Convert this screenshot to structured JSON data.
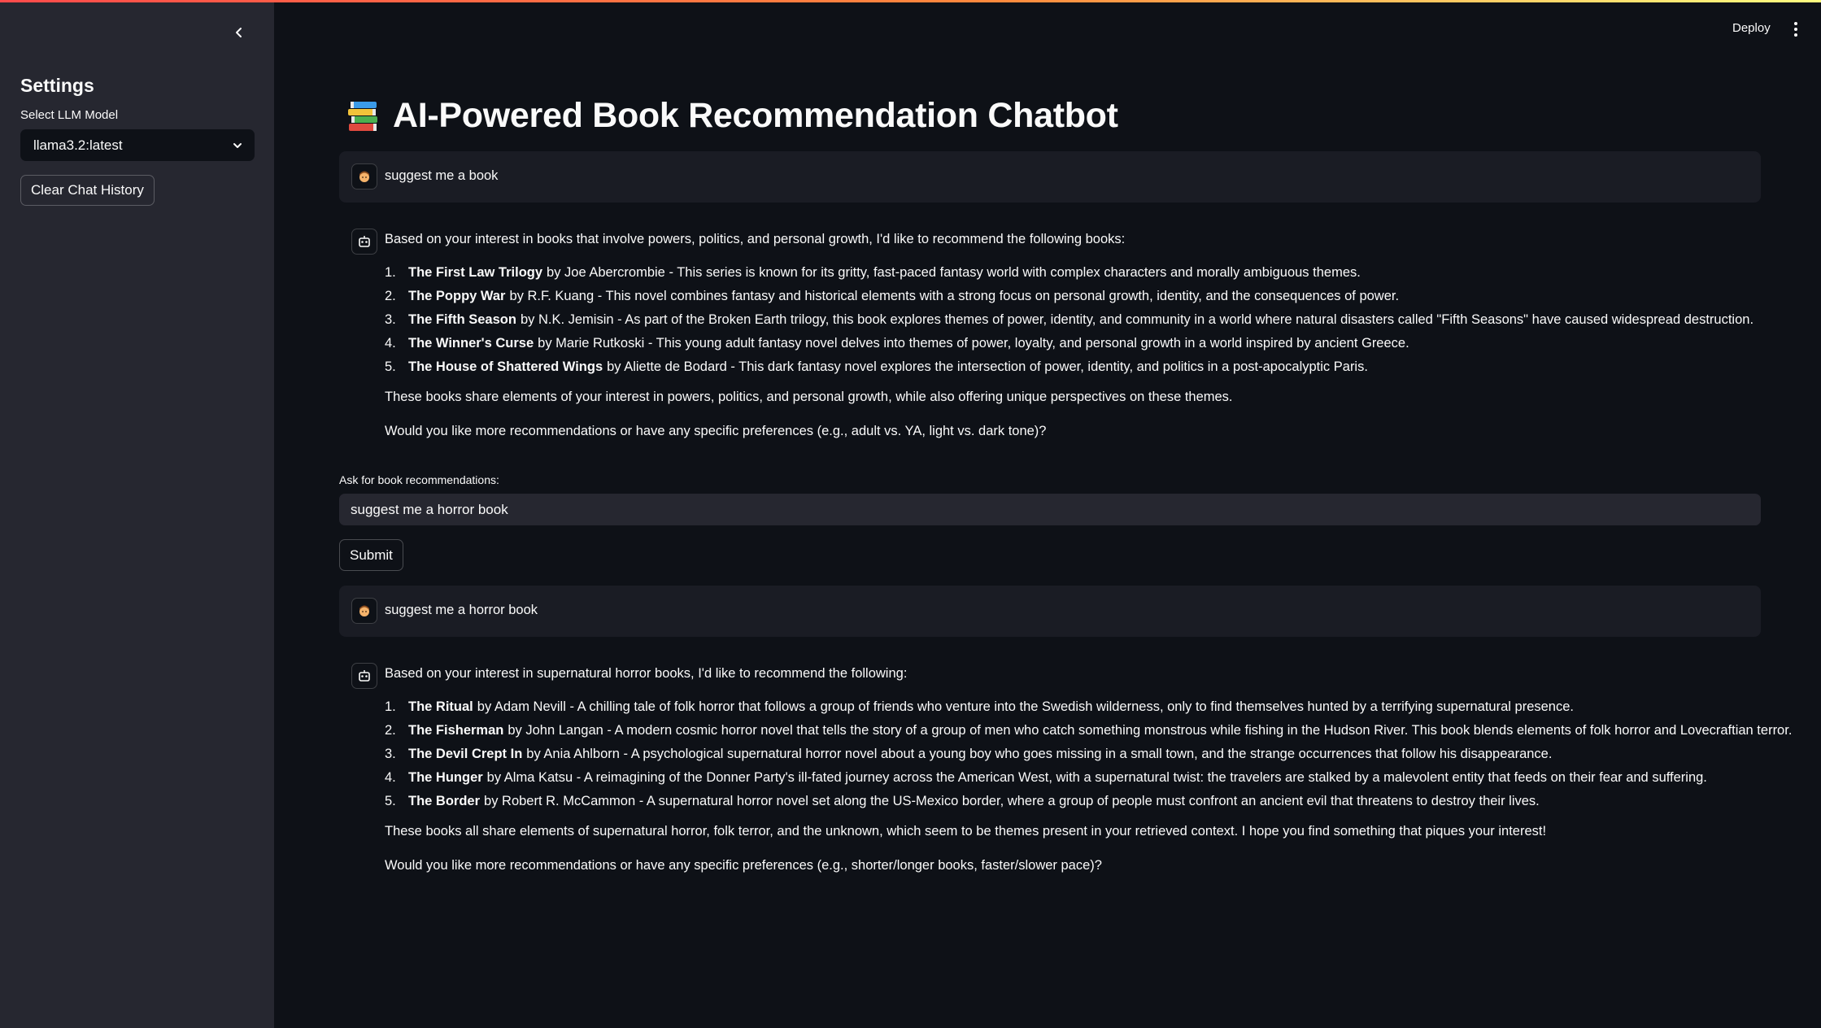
{
  "header": {
    "deploy_label": "Deploy",
    "menu_icon": "kebab-menu-icon"
  },
  "sidebar": {
    "collapse_icon": "chevron-left-icon",
    "title": "Settings",
    "model_label": "Select LLM Model",
    "model_value": "llama3.2:latest",
    "clear_label": "Clear Chat History"
  },
  "page": {
    "title_icon": "books-icon",
    "title": "AI-Powered Book Recommendation Chatbot"
  },
  "chat": [
    {
      "role": "user",
      "avatar_icon": "user-avatar-icon",
      "text": "suggest me a book"
    },
    {
      "role": "assistant",
      "avatar_icon": "bot-avatar-icon",
      "intro": "Based on your interest in books that involve powers, politics, and personal growth, I'd like to recommend the following books:",
      "items": [
        {
          "num": "1.",
          "title": "The First Law Trilogy",
          "rest": "by Joe Abercrombie - This series is known for its gritty, fast-paced fantasy world with complex characters and morally ambiguous themes."
        },
        {
          "num": "2.",
          "title": "The Poppy War",
          "rest": "by R.F. Kuang - This novel combines fantasy and historical elements with a strong focus on personal growth, identity, and the consequences of power."
        },
        {
          "num": "3.",
          "title": "The Fifth Season",
          "rest": "by N.K. Jemisin - As part of the Broken Earth trilogy, this book explores themes of power, identity, and community in a world where natural disasters called \"Fifth Seasons\" have caused widespread destruction."
        },
        {
          "num": "4.",
          "title": "The Winner's Curse",
          "rest": "by Marie Rutkoski - This young adult fantasy novel delves into themes of power, loyalty, and personal growth in a world inspired by ancient Greece."
        },
        {
          "num": "5.",
          "title": "The House of Shattered Wings",
          "rest": "by Aliette de Bodard - This dark fantasy novel explores the intersection of power, identity, and politics in a post-apocalyptic Paris."
        }
      ],
      "para1": "These books share elements of your interest in powers, politics, and personal growth, while also offering unique perspectives on these themes.",
      "para2": "Would you like more recommendations or have any specific preferences (e.g., adult vs. YA, light vs. dark tone)?"
    },
    {
      "role": "user",
      "avatar_icon": "user-avatar-icon",
      "text": "suggest me a horror book"
    },
    {
      "role": "assistant",
      "avatar_icon": "bot-avatar-icon",
      "intro": "Based on your interest in supernatural horror books, I'd like to recommend the following:",
      "items": [
        {
          "num": "1.",
          "title": "The Ritual",
          "rest": "by Adam Nevill - A chilling tale of folk horror that follows a group of friends who venture into the Swedish wilderness, only to find themselves hunted by a terrifying supernatural presence."
        },
        {
          "num": "2.",
          "title": "The Fisherman",
          "rest": "by John Langan - A modern cosmic horror novel that tells the story of a group of men who catch something monstrous while fishing in the Hudson River. This book blends elements of folk horror and Lovecraftian terror."
        },
        {
          "num": "3.",
          "title": "The Devil Crept In",
          "rest": "by Ania Ahlborn - A psychological supernatural horror novel about a young boy who goes missing in a small town, and the strange occurrences that follow his disappearance."
        },
        {
          "num": "4.",
          "title": "The Hunger",
          "rest": "by Alma Katsu - A reimagining of the Donner Party's ill-fated journey across the American West, with a supernatural twist: the travelers are stalked by a malevolent entity that feeds on their fear and suffering."
        },
        {
          "num": "5.",
          "title": "The Border",
          "rest": "by Robert R. McCammon - A supernatural horror novel set along the US-Mexico border, where a group of people must confront an ancient evil that threatens to destroy their lives."
        }
      ],
      "para1": "These books all share elements of supernatural horror, folk terror, and the unknown, which seem to be themes present in your retrieved context. I hope you find something that piques your interest!",
      "para2": "Would you like more recommendations or have any specific preferences (e.g., shorter/longer books, faster/slower pace)?"
    }
  ],
  "form": {
    "label": "Ask for book recommendations:",
    "value": "suggest me a horror book",
    "submit_label": "Submit"
  },
  "colors": {
    "background": "#0e1117",
    "sidebar": "#262730",
    "user_message_bg": "#1a1c24",
    "text": "#fafafa"
  }
}
